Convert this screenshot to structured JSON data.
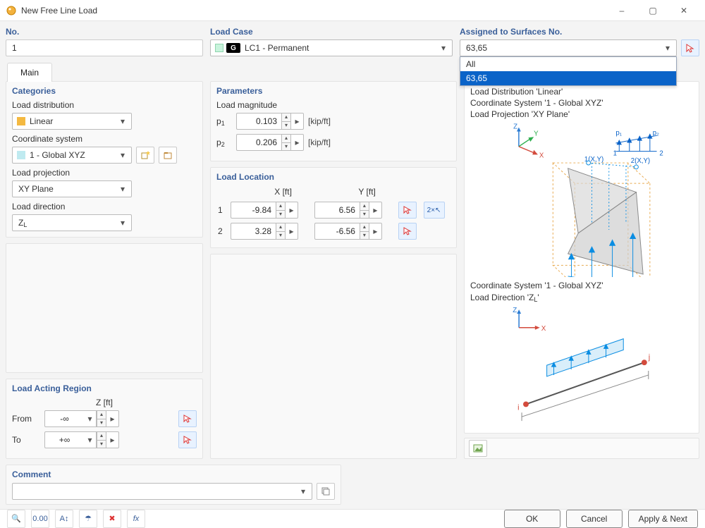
{
  "window": {
    "title": "New Free Line Load"
  },
  "titlebar_buttons": {
    "minimize": "–",
    "maximize": "▢",
    "close": "✕"
  },
  "header": {
    "no_label": "No.",
    "no_value": "1",
    "loadcase_label": "Load Case",
    "loadcase_value": "LC1 - Permanent",
    "loadcase_badge": "G",
    "assigned_label": "Assigned to Surfaces No.",
    "assigned_value": "63,65",
    "assigned_dropdown": {
      "opt_all": "All",
      "opt_sel": "63,65"
    }
  },
  "tabs": {
    "main": "Main"
  },
  "categories": {
    "title": "Categories",
    "load_distribution_label": "Load distribution",
    "load_distribution_value": "Linear",
    "coord_system_label": "Coordinate system",
    "coord_system_value": "1 - Global XYZ",
    "load_projection_label": "Load projection",
    "load_projection_value": "XY Plane",
    "load_direction_label": "Load direction",
    "load_direction_value": "ZL"
  },
  "region": {
    "title": "Load Acting Region",
    "col_label": "Z [ft]",
    "from_label": "From",
    "from_value": "-∞",
    "to_label": "To",
    "to_value": "+∞"
  },
  "parameters": {
    "title": "Parameters",
    "magnitude_label": "Load magnitude",
    "p1_label": "p",
    "p1_sub": "1",
    "p1_value": "0.103",
    "p1_unit": "[kip/ft]",
    "p2_label": "p",
    "p2_sub": "2",
    "p2_value": "0.206",
    "p2_unit": "[kip/ft]"
  },
  "location": {
    "title": "Load Location",
    "x_header": "X [ft]",
    "y_header": "Y [ft]",
    "rows": [
      {
        "idx": "1",
        "x": "-9.84",
        "y": "6.56"
      },
      {
        "idx": "2",
        "x": "3.28",
        "y": "-6.56"
      }
    ]
  },
  "comment": {
    "title": "Comment",
    "value": ""
  },
  "preview": {
    "line1": "Load Distribution 'Linear'",
    "line2": "Coordinate System '1 - Global XYZ'",
    "line3": "Load Projection 'XY Plane'",
    "line4": "Coordinate System '1 - Global XYZ'",
    "line5": "Load Direction 'ZL'",
    "axis_z": "Z",
    "axis_y": "Y",
    "axis_x": "X",
    "lbl_p1": "p₁",
    "lbl_p2": "p₂",
    "lbl_1": "1",
    "lbl_2": "2",
    "lbl_1xy": "1(X,Y)",
    "lbl_2xy": "2(X,Y)",
    "lbl_i": "i",
    "lbl_j": "j"
  },
  "footer": {
    "ok": "OK",
    "cancel": "Cancel",
    "apply_next": "Apply & Next",
    "tool1": "?",
    "tool2": "0.00",
    "tool3": "A↕",
    "tool4": "☂",
    "tool5": "✖",
    "tool6": "fx"
  }
}
